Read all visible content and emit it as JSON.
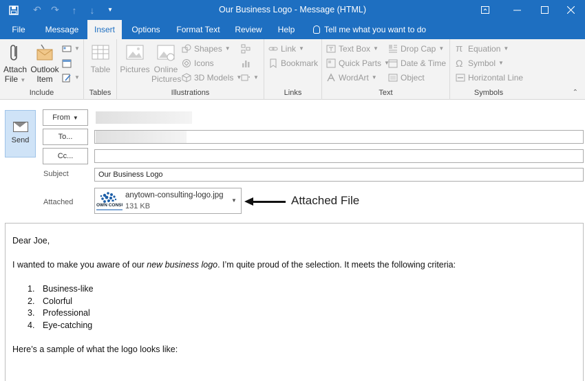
{
  "window": {
    "title": "Our Business Logo  -  Message (HTML)"
  },
  "tabs": [
    "File",
    "Message",
    "Insert",
    "Options",
    "Format Text",
    "Review",
    "Help"
  ],
  "active_tab": "Insert",
  "tell_me": "Tell me what you want to do",
  "ribbon": {
    "include": {
      "label": "Include",
      "attach_file": [
        "Attach",
        "File"
      ],
      "outlook_item": [
        "Outlook",
        "Item"
      ]
    },
    "tables": {
      "label": "Tables",
      "table": "Table"
    },
    "illustrations": {
      "label": "Illustrations",
      "pictures": "Pictures",
      "online_pictures": [
        "Online",
        "Pictures"
      ],
      "shapes": "Shapes",
      "icons": "Icons",
      "models": "3D Models"
    },
    "links": {
      "label": "Links",
      "link": "Link",
      "bookmark": "Bookmark"
    },
    "text": {
      "label": "Text",
      "text_box": "Text Box",
      "quick_parts": "Quick Parts",
      "wordart": "WordArt",
      "drop_cap": "Drop Cap",
      "date_time": "Date & Time",
      "object": "Object"
    },
    "symbols": {
      "label": "Symbols",
      "equation": "Equation",
      "symbol": "Symbol",
      "horizontal_line": "Horizontal Line"
    }
  },
  "header": {
    "send": "Send",
    "from": "From",
    "to": "To...",
    "cc": "Cc...",
    "subject_label": "Subject",
    "subject_value": "Our Business Logo",
    "attached_label": "Attached"
  },
  "attachment": {
    "filename": "anytown-consulting-logo.jpg",
    "size": "131 KB",
    "thumb_text": "OWN CONSU"
  },
  "callout": "Attached File",
  "message": {
    "greeting": "Dear Joe,",
    "intro_before": "I wanted to make you aware of our ",
    "intro_emphasis": "new business logo",
    "intro_after": ". I’m quite proud of the selection. It meets the following criteria:",
    "criteria": [
      {
        "num": "1.",
        "text": "Business-like"
      },
      {
        "num": "2.",
        "text": "Colorful"
      },
      {
        "num": "3.",
        "text": "Professional"
      },
      {
        "num": "4.",
        "text": "Eye-catching"
      }
    ],
    "closing": "Here’s a sample of what the logo looks like:"
  },
  "colors": {
    "accent": "#1e6fc1",
    "ribbon_bg": "#f3f3f3",
    "send_bg": "#cfe3f7"
  }
}
